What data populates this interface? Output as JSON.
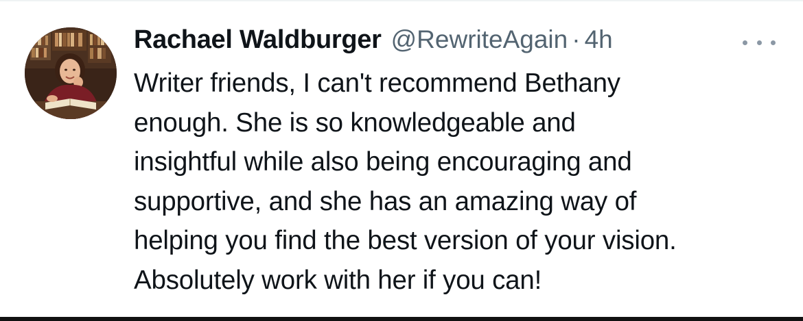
{
  "tweet": {
    "display_name": "Rachael Waldburger",
    "handle": "@RewriteAgain",
    "separator": "·",
    "time": "4h",
    "text": "Writer friends, I can't recommend Bethany\nenough. She is so knowledgeable and\ninsightful while also being encouraging and\nsupportive, and she has an amazing way of\nhelping you find the best version of your vision.\nAbsolutely work with her if you can!",
    "more_icon": "more-horizontal-icon"
  },
  "colors": {
    "text_primary": "#0f1419",
    "text_secondary": "#536471",
    "background": "#ffffff"
  }
}
